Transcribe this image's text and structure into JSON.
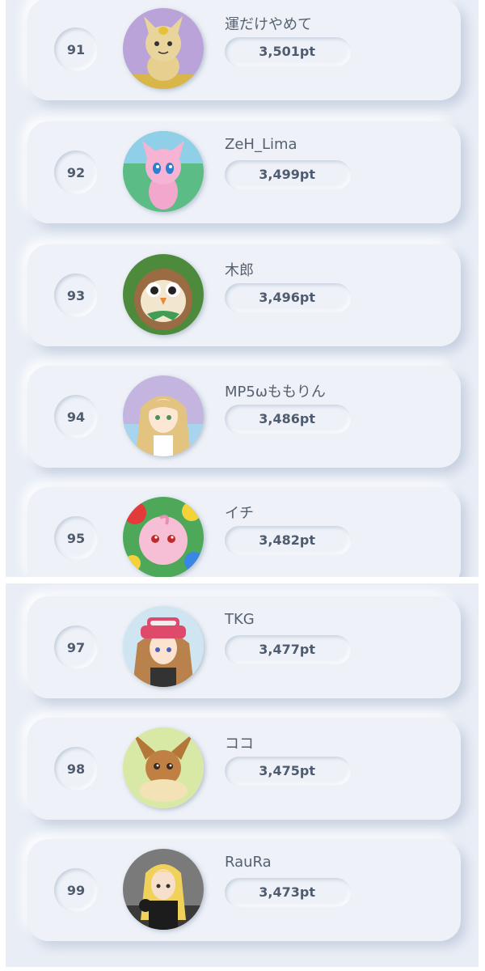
{
  "ranking": {
    "top_group": [
      {
        "rank": "91",
        "name": "運だけやめて",
        "score": "3,501pt",
        "avatar": "meowth-icon"
      },
      {
        "rank": "92",
        "name": "ZeH_Lima",
        "score": "3,499pt",
        "avatar": "mew-icon"
      },
      {
        "rank": "93",
        "name": "木郎",
        "score": "3,496pt",
        "avatar": "rowlet-icon"
      },
      {
        "rank": "94",
        "name": "MP5ωももりん",
        "score": "3,486pt",
        "avatar": "lillie-icon"
      },
      {
        "rank": "95",
        "name": "イチ",
        "score": "3,482pt",
        "avatar": "igglybuff-icon"
      }
    ],
    "bottom_group": [
      {
        "rank": "97",
        "name": "TKG",
        "score": "3,477pt",
        "avatar": "serena-icon"
      },
      {
        "rank": "98",
        "name": "ココ",
        "score": "3,475pt",
        "avatar": "eevee-icon"
      },
      {
        "rank": "99",
        "name": "RauRa",
        "score": "3,473pt",
        "avatar": "cynthia-icon"
      }
    ]
  }
}
